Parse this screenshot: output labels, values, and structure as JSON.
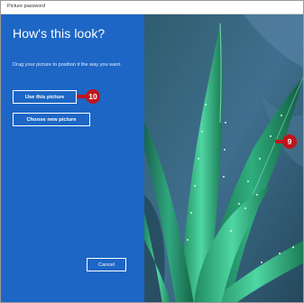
{
  "window": {
    "title": "Picture password"
  },
  "panel": {
    "heading": "How's this look?",
    "instructions": "Drag your picture to position it the way you want.",
    "use_label": "Use this picture",
    "choose_label": "Choose new picture",
    "cancel_label": "Cancel",
    "accent_color": "#1d66c5"
  },
  "callouts": {
    "step_use": "10",
    "step_picture": "9",
    "color": "#c0141c"
  },
  "preview": {
    "subject": "aloe plant photo",
    "icon": "aloe-plant-image"
  }
}
